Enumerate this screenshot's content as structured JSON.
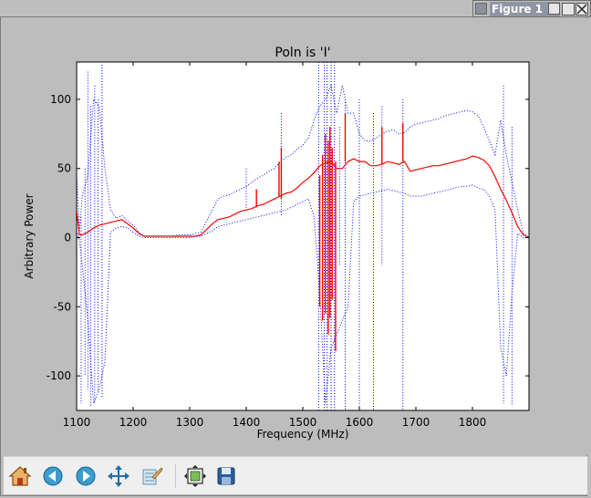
{
  "window": {
    "title": "Figure 1"
  },
  "toolbar": {
    "buttons": [
      {
        "name": "home-icon"
      },
      {
        "name": "back-icon"
      },
      {
        "name": "forward-icon"
      },
      {
        "name": "pan-icon"
      },
      {
        "name": "zoom-icon"
      },
      {
        "name": "subplots-icon"
      },
      {
        "name": "save-icon"
      }
    ]
  },
  "chart_data": {
    "type": "line",
    "title": "Poln is 'I'",
    "xlabel": "Frequency (MHz)",
    "ylabel": "Arbitrary Power",
    "xlim": [
      1100,
      1900
    ],
    "ylim": [
      -125,
      127
    ],
    "xticks": [
      1100,
      1200,
      1300,
      1400,
      1500,
      1600,
      1700,
      1800
    ],
    "yticks": [
      -100,
      -50,
      0,
      50,
      100
    ],
    "grid": false,
    "colors": {
      "mean": "#ff0000",
      "bounds": "#0000ff"
    },
    "series": [
      {
        "style": "solid",
        "color": "#ff0000",
        "x": [
          1100,
          1105,
          1110,
          1120,
          1130,
          1140,
          1150,
          1160,
          1170,
          1180,
          1190,
          1200,
          1210,
          1220,
          1230,
          1240,
          1250,
          1260,
          1270,
          1280,
          1290,
          1300,
          1310,
          1320,
          1330,
          1340,
          1350,
          1360,
          1370,
          1380,
          1390,
          1400,
          1410,
          1420,
          1430,
          1440,
          1450,
          1460,
          1470,
          1480,
          1490,
          1500,
          1510,
          1520,
          1530,
          1540,
          1550,
          1560,
          1570,
          1580,
          1590,
          1600,
          1610,
          1620,
          1630,
          1640,
          1650,
          1660,
          1670,
          1680,
          1690,
          1700,
          1710,
          1720,
          1730,
          1740,
          1750,
          1760,
          1770,
          1780,
          1790,
          1800,
          1810,
          1820,
          1830,
          1840,
          1850,
          1860,
          1870,
          1880,
          1890,
          1900
        ],
        "y": [
          20,
          2,
          2,
          4,
          7,
          9,
          10,
          11,
          12,
          13,
          10,
          7,
          3,
          1,
          1,
          1,
          1,
          1,
          1,
          1,
          1,
          1,
          1,
          2,
          6,
          10,
          13,
          14,
          15,
          17,
          19,
          20,
          21,
          23,
          24,
          26,
          28,
          30,
          32,
          33,
          36,
          40,
          43,
          47,
          52,
          54,
          55,
          50,
          50,
          55,
          57,
          55,
          55,
          52,
          52,
          53,
          55,
          54,
          53,
          55,
          48,
          49,
          50,
          51,
          52,
          52,
          53,
          54,
          55,
          56,
          57,
          59,
          58,
          56,
          52,
          44,
          35,
          27,
          18,
          8,
          2,
          0
        ]
      },
      {
        "style": "dotted",
        "color": "#0000ff",
        "x": [
          1100,
          1105,
          1110,
          1120,
          1130,
          1140,
          1150,
          1160,
          1170,
          1180,
          1190,
          1200,
          1210,
          1220,
          1230,
          1240,
          1250,
          1260,
          1270,
          1280,
          1290,
          1300,
          1310,
          1320,
          1330,
          1340,
          1350,
          1360,
          1370,
          1380,
          1390,
          1400,
          1410,
          1420,
          1430,
          1440,
          1450,
          1460,
          1470,
          1480,
          1490,
          1500,
          1510,
          1520,
          1530,
          1540,
          1550,
          1560,
          1570,
          1580,
          1590,
          1600,
          1610,
          1620,
          1630,
          1640,
          1650,
          1660,
          1670,
          1680,
          1690,
          1700,
          1710,
          1720,
          1730,
          1740,
          1750,
          1760,
          1770,
          1780,
          1790,
          1800,
          1810,
          1820,
          1830,
          1840,
          1850,
          1860,
          1870,
          1880,
          1890,
          1900
        ],
        "y": [
          45,
          5,
          30,
          45,
          100,
          95,
          50,
          20,
          14,
          16,
          12,
          9,
          4,
          1,
          1,
          1,
          1,
          1,
          1,
          2,
          2,
          2,
          3,
          4,
          12,
          20,
          28,
          30,
          31,
          33,
          35,
          37,
          40,
          43,
          45,
          48,
          50,
          55,
          58,
          60,
          64,
          67,
          72,
          85,
          95,
          100,
          110,
          90,
          110,
          90,
          90,
          75,
          70,
          70,
          72,
          75,
          77,
          78,
          75,
          76,
          80,
          82,
          83,
          84,
          85,
          86,
          88,
          89,
          90,
          91,
          92,
          91,
          88,
          80,
          70,
          60,
          85,
          60,
          40,
          20,
          3,
          0
        ]
      },
      {
        "style": "dotted",
        "color": "#0000ff",
        "x": [
          1100,
          1105,
          1110,
          1120,
          1130,
          1140,
          1150,
          1160,
          1170,
          1180,
          1190,
          1200,
          1210,
          1220,
          1230,
          1240,
          1250,
          1260,
          1270,
          1280,
          1290,
          1300,
          1310,
          1320,
          1330,
          1340,
          1350,
          1360,
          1370,
          1380,
          1390,
          1400,
          1410,
          1420,
          1430,
          1440,
          1450,
          1460,
          1470,
          1480,
          1490,
          1500,
          1510,
          1520,
          1530,
          1540,
          1550,
          1560,
          1570,
          1580,
          1590,
          1600,
          1610,
          1620,
          1630,
          1640,
          1650,
          1660,
          1670,
          1680,
          1690,
          1700,
          1710,
          1720,
          1730,
          1740,
          1750,
          1760,
          1770,
          1780,
          1790,
          1800,
          1810,
          1820,
          1830,
          1840,
          1850,
          1860,
          1870,
          1880,
          1890,
          1900
        ],
        "y": [
          5,
          -2,
          -20,
          -60,
          -120,
          -110,
          -90,
          4,
          7,
          8,
          7,
          4,
          1,
          0,
          0,
          0,
          0,
          0,
          0,
          0,
          0,
          0,
          1,
          1,
          3,
          5,
          8,
          9,
          10,
          11,
          12,
          13,
          14,
          15,
          16,
          17,
          18,
          19,
          20,
          22,
          24,
          26,
          28,
          15,
          -40,
          -120,
          -80,
          -70,
          -60,
          -50,
          26,
          30,
          31,
          32,
          33,
          34,
          35,
          34,
          33,
          32,
          30,
          30,
          30,
          31,
          32,
          33,
          34,
          35,
          36,
          37,
          37,
          38,
          36,
          35,
          30,
          20,
          -80,
          -100,
          -40,
          3,
          0,
          0
        ]
      }
    ],
    "spikes": {
      "red": [
        {
          "x": 1418,
          "y1": 22,
          "y2": 35
        },
        {
          "x": 1458,
          "y1": 30,
          "y2": 55
        },
        {
          "x": 1462,
          "y1": 28,
          "y2": 65
        },
        {
          "x": 1530,
          "y1": 45,
          "y2": -50
        },
        {
          "x": 1535,
          "y1": 60,
          "y2": -60
        },
        {
          "x": 1540,
          "y1": 75,
          "y2": -55
        },
        {
          "x": 1545,
          "y1": 70,
          "y2": -70
        },
        {
          "x": 1548,
          "y1": 80,
          "y2": -58
        },
        {
          "x": 1552,
          "y1": 65,
          "y2": -45
        },
        {
          "x": 1558,
          "y1": 55,
          "y2": -82
        },
        {
          "x": 1575,
          "y1": 55,
          "y2": 90
        },
        {
          "x": 1640,
          "y1": 53,
          "y2": 80
        },
        {
          "x": 1677,
          "y1": 55,
          "y2": 83
        }
      ],
      "blue": [
        {
          "x": 1108,
          "y1": 15,
          "y2": -120
        },
        {
          "x": 1115,
          "y1": 50,
          "y2": -100
        },
        {
          "x": 1120,
          "y1": 120,
          "y2": -110
        },
        {
          "x": 1125,
          "y1": 95,
          "y2": -122
        },
        {
          "x": 1132,
          "y1": 110,
          "y2": -118
        },
        {
          "x": 1138,
          "y1": 100,
          "y2": -112
        },
        {
          "x": 1145,
          "y1": 125,
          "y2": -115
        },
        {
          "x": 1400,
          "y1": 50,
          "y2": 20
        },
        {
          "x": 1462,
          "y1": 90,
          "y2": 15
        },
        {
          "x": 1528,
          "y1": 127,
          "y2": -125
        },
        {
          "x": 1538,
          "y1": 127,
          "y2": -125
        },
        {
          "x": 1543,
          "y1": 127,
          "y2": -125
        },
        {
          "x": 1550,
          "y1": 127,
          "y2": -125
        },
        {
          "x": 1556,
          "y1": 127,
          "y2": -125
        },
        {
          "x": 1565,
          "y1": 80,
          "y2": -20
        },
        {
          "x": 1575,
          "y1": 100,
          "y2": -125
        },
        {
          "x": 1600,
          "y1": 100,
          "y2": -125
        },
        {
          "x": 1625,
          "y1": 90,
          "y2": -125
        },
        {
          "x": 1640,
          "y1": 95,
          "y2": -20
        },
        {
          "x": 1677,
          "y1": 100,
          "y2": -125
        },
        {
          "x": 1855,
          "y1": 110,
          "y2": -120
        },
        {
          "x": 1870,
          "y1": 80,
          "y2": -122
        }
      ]
    }
  }
}
